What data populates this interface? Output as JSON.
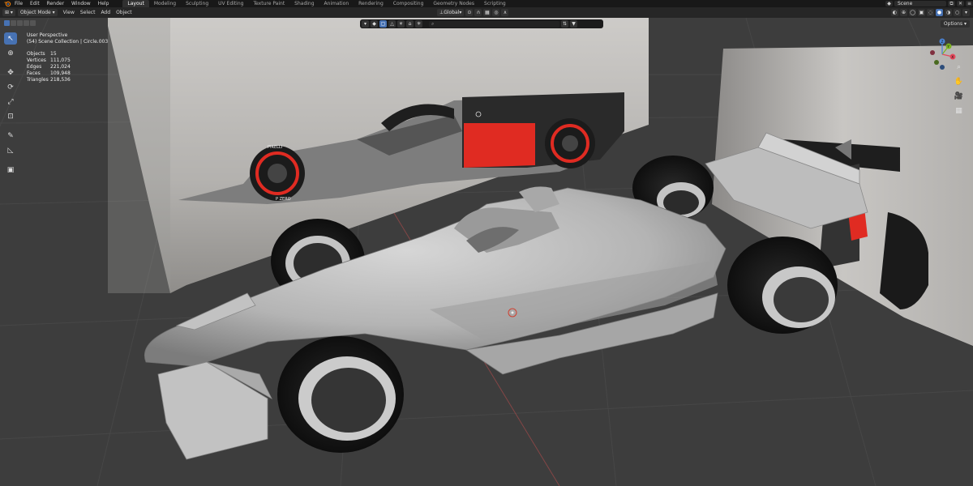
{
  "menu": {
    "items": [
      "File",
      "Edit",
      "Render",
      "Window",
      "Help"
    ],
    "workspace_tabs": [
      "Layout",
      "Modeling",
      "Sculpting",
      "UV Editing",
      "Texture Paint",
      "Shading",
      "Animation",
      "Rendering",
      "Compositing",
      "Geometry Nodes",
      "Scripting"
    ],
    "active_tab": "Layout",
    "scene_name": "Scene"
  },
  "header": {
    "mode": "Object Mode",
    "menus": [
      "View",
      "Select",
      "Add",
      "Object"
    ],
    "transform_orientation": "Global",
    "search_placeholder": "",
    "options_label": "Options"
  },
  "overlay": {
    "view_name": "User Perspective",
    "collection": "(54) Scene Collection | Circle.003",
    "stats": [
      {
        "label": "Objects",
        "value": "15"
      },
      {
        "label": "Vertices",
        "value": "111,075"
      },
      {
        "label": "Edges",
        "value": "221,024"
      },
      {
        "label": "Faces",
        "value": "109,948"
      },
      {
        "label": "Triangles",
        "value": "218,536"
      }
    ]
  },
  "reference_image": {
    "sponsor_text": "PIRELLI",
    "tyre_text": "P ZERO"
  },
  "gizmo": {
    "axes": [
      "X",
      "Y",
      "Z"
    ]
  },
  "toolbar": {
    "tools": [
      "select-box",
      "cursor",
      "move",
      "rotate",
      "scale",
      "transform",
      "annotate",
      "measure",
      "add-cube"
    ]
  },
  "colors": {
    "accent": "#4772b3",
    "viewport_bg": "#3d3d3d",
    "red_livery": "#e02b22",
    "axis_x": "#e4485b",
    "axis_y": "#7bb320",
    "axis_z": "#4d86d9"
  }
}
